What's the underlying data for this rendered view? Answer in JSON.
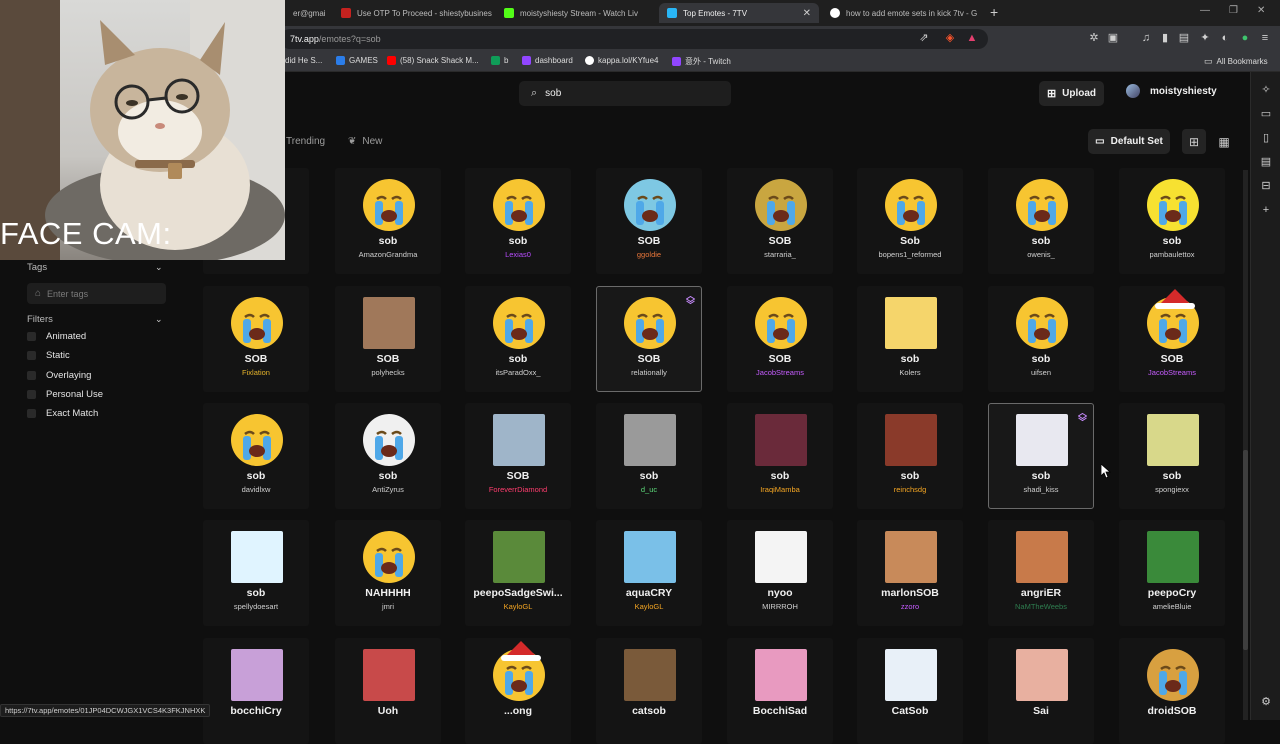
{
  "browser": {
    "tabs": [
      {
        "label": "er@gmai",
        "color": "#d93025",
        "active": false
      },
      {
        "label": "Use OTP To Proceed - shiestybusines",
        "color": "#c5221f",
        "active": false
      },
      {
        "label": "moistyshiesty Stream - Watch Liv",
        "color": "#53fc18",
        "active": false
      },
      {
        "label": "Top Emotes - 7TV",
        "color": "#29b6f6",
        "active": true
      },
      {
        "label": "how to add emote sets in kick 7tv - G",
        "color": "#ffffff",
        "active": false
      }
    ],
    "url_host": "7tv.app",
    "url_path": "/emotes?q=sob",
    "bookmarks": [
      {
        "label": "did He S...",
        "color": "#555"
      },
      {
        "label": "GAMES",
        "color": "#2b7de9"
      },
      {
        "label": "(58) Snack Shack M...",
        "color": "#ff0000"
      },
      {
        "label": "b",
        "color": "#0f9d58"
      },
      {
        "label": "dashboard",
        "color": "#9146ff"
      },
      {
        "label": "kappa.lol/KYfue4",
        "color": "#ffffff"
      },
      {
        "label": "意外 - Twitch",
        "color": "#9146ff"
      }
    ],
    "all_bookmarks": "All Bookmarks",
    "status_url": "https://7tv.app/emotes/01JP04DCWJGX1VCS4K3FKJNHXK"
  },
  "header": {
    "search_value": "sob",
    "upload_label": "Upload",
    "username": "moistyshiesty"
  },
  "nav": {
    "trending": "Trending",
    "new": "New",
    "default_set": "Default Set"
  },
  "filters": {
    "tags_label": "Tags",
    "tags_placeholder": "Enter tags",
    "filters_label": "Filters",
    "options": [
      "Animated",
      "Static",
      "Overlaying",
      "Personal Use",
      "Exact Match"
    ]
  },
  "facecam": {
    "label": "FACE CAM:"
  },
  "emotes": [
    {
      "name": "",
      "author": "",
      "author_color": "#d0d0d0",
      "icon": "partially-hidden-emote",
      "bg": "#333"
    },
    {
      "name": "sob",
      "author": "AmazonGrandma",
      "author_color": "#d0d0d0",
      "icon": "crying-emoji-icon",
      "bg": "#f7c531"
    },
    {
      "name": "sob",
      "author": "Lexias0",
      "author_color": "#b84cff",
      "icon": "crying-emoji-icon",
      "bg": "#f7c531"
    },
    {
      "name": "SOB",
      "author": "ggoldie",
      "author_color": "#e8763a",
      "icon": "crying-keffiyeh-emoji-icon",
      "bg": "#7ec8e3"
    },
    {
      "name": "SOB",
      "author": "starraria_",
      "author_color": "#d0d0d0",
      "icon": "pixelated-crying-emoji-icon",
      "bg": "#c9a640"
    },
    {
      "name": "Sob",
      "author": "bopens1_reformed",
      "author_color": "#d0d0d0",
      "icon": "crying-emoji-icon",
      "bg": "#f7c531"
    },
    {
      "name": "sob",
      "author": "owenis_",
      "author_color": "#d0d0d0",
      "icon": "crying-emoji-icon",
      "bg": "#f7c531"
    },
    {
      "name": "sob",
      "author": "pambaulettox",
      "author_color": "#d0d0d0",
      "icon": "wailing-emoji-icon",
      "bg": "#f7e131"
    },
    {
      "name": "SOB",
      "author": "Fixlation",
      "author_color": "#e3b22b",
      "icon": "crying-emoji-icon",
      "bg": "#f7c531"
    },
    {
      "name": "SOB",
      "author": "polyhecks",
      "author_color": "#d0d0d0",
      "icon": "crying-man-photo-icon",
      "bg": "#a0785a"
    },
    {
      "name": "sob",
      "author": "itsParadOxx_",
      "author_color": "#d0d0d0",
      "icon": "melting-crying-emoji-icon",
      "bg": "#f7c531"
    },
    {
      "name": "SOB",
      "author": "relationally",
      "author_color": "#d0d0d0",
      "icon": "crying-emoji-icon",
      "bg": "#f7c531"
    },
    {
      "name": "SOB",
      "author": "JacobStreams",
      "author_color": "#c65cff",
      "icon": "crying-emoji-icon",
      "bg": "#f7c531"
    },
    {
      "name": "sob",
      "author": "Kolers",
      "author_color": "#d0d0d0",
      "icon": "cartoon-crying-icon",
      "bg": "#f5d56b"
    },
    {
      "name": "sob",
      "author": "uifsen",
      "author_color": "#d0d0d0",
      "icon": "puddle-crying-emoji-icon",
      "bg": "#f7c531"
    },
    {
      "name": "SOB",
      "author": "JacobStreams",
      "author_color": "#c65cff",
      "icon": "santa-crying-emoji-icon",
      "bg": "#f7c531"
    },
    {
      "name": "sob",
      "author": "davidlxw",
      "author_color": "#d0d0d0",
      "icon": "crying-emoji-icon",
      "bg": "#f7c531"
    },
    {
      "name": "sob",
      "author": "AntiZyrus",
      "author_color": "#d0d0d0",
      "icon": "white-crying-emoji-icon",
      "bg": "#f0f0f0"
    },
    {
      "name": "SOB",
      "author": "ForeverrDiamond",
      "author_color": "#ff3d6e",
      "icon": "crying-person-photo-icon",
      "bg": "#9fb5c9"
    },
    {
      "name": "sob",
      "author": "d_uc",
      "author_color": "#5ddc7b",
      "icon": "crying-cat-photo-icon",
      "bg": "#9a9a9a"
    },
    {
      "name": "sob",
      "author": "IraqiMamba",
      "author_color": "#f5a623",
      "icon": "crying-face-photo-icon",
      "bg": "#6a2a3a"
    },
    {
      "name": "sob",
      "author": "reinchsdg",
      "author_color": "#f5a623",
      "icon": "fire-crying-photo-icon",
      "bg": "#8a3a2a"
    },
    {
      "name": "sob",
      "author": "shadi_kiss",
      "author_color": "#d0d0d0",
      "icon": "white-blob-crying-icon",
      "bg": "#e8e8f0"
    },
    {
      "name": "sob",
      "author": "spongiexx",
      "author_color": "#d0d0d0",
      "icon": "blob-crying-icon",
      "bg": "#d8d88a"
    },
    {
      "name": "sob",
      "author": "spellydoesart",
      "author_color": "#d0d0d0",
      "icon": "stick-figure-crying-icon",
      "bg": "#e0f4ff"
    },
    {
      "name": "NAHHHH",
      "author": "jmri",
      "author_color": "#d0d0d0",
      "icon": "crying-emoji-icon",
      "bg": "#f7c531"
    },
    {
      "name": "peepoSadgeSwi...",
      "author": "KayloGL",
      "author_color": "#f5a623",
      "icon": "frog-swing-icon",
      "bg": "#5a8a3a"
    },
    {
      "name": "aquaCRY",
      "author": "KayloGL",
      "author_color": "#f5a623",
      "icon": "anime-girl-crying-icon",
      "bg": "#7ac0e8"
    },
    {
      "name": "nyoo",
      "author": "MIRRROH",
      "author_color": "#d0d0d0",
      "icon": "white-cat-crying-icon",
      "bg": "#f4f4f4"
    },
    {
      "name": "marlonSOB",
      "author": "zzoro",
      "author_color": "#c65cff",
      "icon": "crying-man-cartoon-icon",
      "bg": "#c88a5a"
    },
    {
      "name": "angriER",
      "author": "NaMTheWeebs",
      "author_color": "#2e7d4f",
      "icon": "screaming-face-photo-icon",
      "bg": "#c87a4a"
    },
    {
      "name": "peepoCry",
      "author": "amelieBluie",
      "author_color": "#d0d0d0",
      "icon": "frog-crying-icon",
      "bg": "#3a8a3a"
    },
    {
      "name": "bocchiCry",
      "author": "",
      "author_color": "#d0d0d0",
      "icon": "anime-girl-crying-icon",
      "bg": "#c8a0d8"
    },
    {
      "name": "Uoh",
      "author": "",
      "author_color": "#d0d0d0",
      "icon": "blurred-crying-icon",
      "bg": "#c84a4a"
    },
    {
      "name": "...ong",
      "author": "",
      "author_color": "#d0d0d0",
      "icon": "santa-crying-emoji-icon",
      "bg": "#f7c531"
    },
    {
      "name": "catsob",
      "author": "",
      "author_color": "#d0d0d0",
      "icon": "crying-cat-photo-icon",
      "bg": "#7a5a3a"
    },
    {
      "name": "BocchiSad",
      "author": "",
      "author_color": "#d0d0d0",
      "icon": "anime-girl-sad-icon",
      "bg": "#e89ac0"
    },
    {
      "name": "CatSob",
      "author": "",
      "author_color": "#d0d0d0",
      "icon": "white-cat-crying-icon",
      "bg": "#e8f0f8"
    },
    {
      "name": "Sai",
      "author": "",
      "author_color": "#d0d0d0",
      "icon": "anime-girl-crying-icon",
      "bg": "#e8b0a0"
    },
    {
      "name": "droidSOB",
      "author": "",
      "author_color": "#d0d0d0",
      "icon": "pixelated-crying-emoji-icon",
      "bg": "#d8a040"
    }
  ]
}
